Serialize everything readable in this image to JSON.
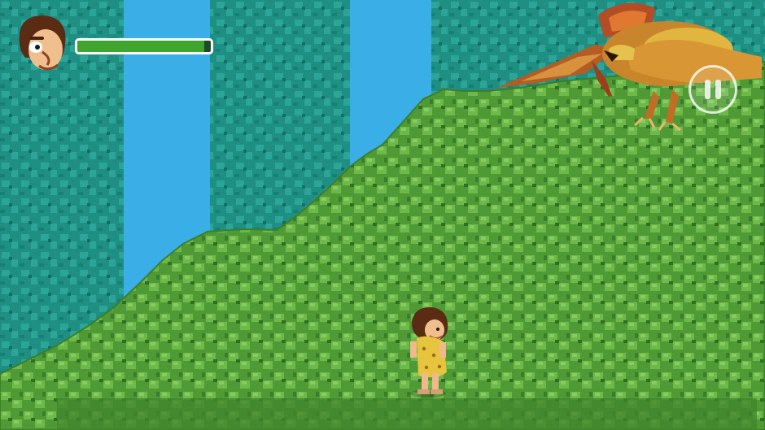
{
  "hud": {
    "player_portrait_icon": "caveman-face-icon",
    "health": {
      "fraction": 0.95,
      "fill_color": "#3fa52e",
      "border_color": "#ffffff"
    },
    "pause_icon": "pause-icon"
  },
  "scene": {
    "sky_color": "#3aaee6",
    "tree_trunk_color": "#1e8f82",
    "hill_color": "#4f9a34",
    "player_sprite": "caveman-sprite",
    "enemy_sprite": "pterodactyl-sprite"
  }
}
